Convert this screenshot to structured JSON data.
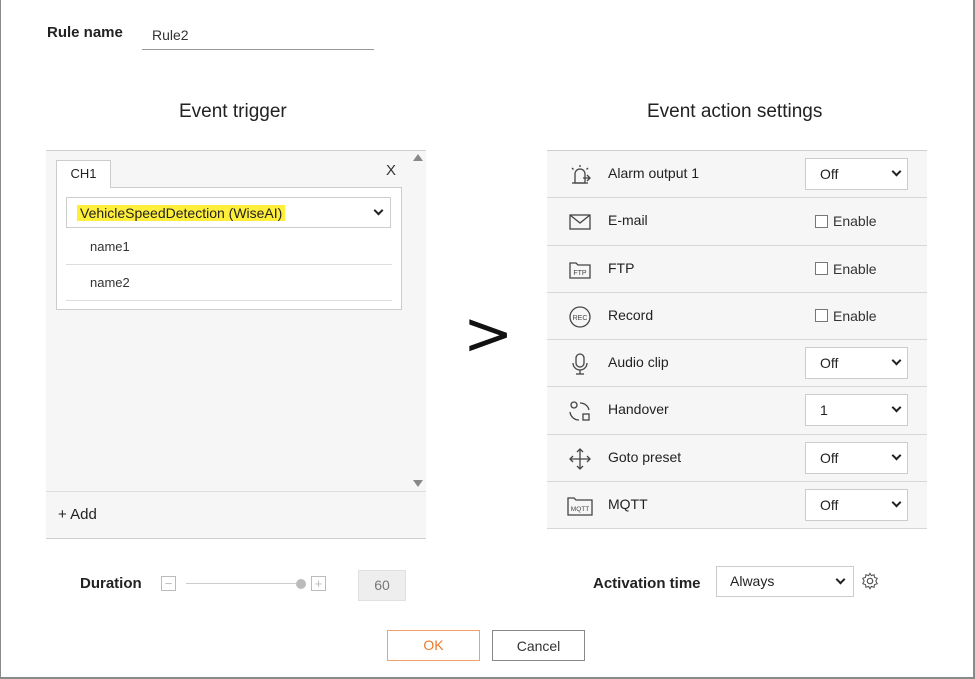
{
  "rule": {
    "label": "Rule name",
    "value": "Rule2"
  },
  "event_trigger": {
    "title": "Event trigger",
    "channel_tab": "CH1",
    "close_label": "X",
    "event_select": "VehicleSpeedDetection (WiseAI)",
    "names": [
      "name1",
      "name2"
    ],
    "add_label": "+ Add"
  },
  "separator_glyph": ">",
  "event_action": {
    "title": "Event action settings",
    "rows": [
      {
        "label": "Alarm output 1",
        "icon": "alarm-output-icon",
        "control": "dropdown",
        "value": "Off"
      },
      {
        "label": "E-mail",
        "icon": "envelope-icon",
        "control": "checkbox",
        "value": "Enable"
      },
      {
        "label": "FTP",
        "icon": "ftp-icon",
        "control": "checkbox",
        "value": "Enable"
      },
      {
        "label": "Record",
        "icon": "rec-icon",
        "control": "checkbox",
        "value": "Enable"
      },
      {
        "label": "Audio clip",
        "icon": "microphone-icon",
        "control": "dropdown",
        "value": "Off"
      },
      {
        "label": "Handover",
        "icon": "handover-icon",
        "control": "dropdown",
        "value": "1"
      },
      {
        "label": "Goto preset",
        "icon": "move-arrows-icon",
        "control": "dropdown",
        "value": "Off"
      },
      {
        "label": "MQTT",
        "icon": "mqtt-icon",
        "control": "dropdown",
        "value": "Off"
      }
    ]
  },
  "duration": {
    "label": "Duration",
    "minus": "−",
    "plus": "+",
    "value": "60",
    "level": 1.0
  },
  "activation": {
    "label": "Activation time",
    "value": "Always"
  },
  "buttons": {
    "ok": "OK",
    "cancel": "Cancel"
  },
  "colors": {
    "highlight": "#fff000",
    "ok_accent": "#e87a2c",
    "panel_bg": "#f6f6f6"
  }
}
